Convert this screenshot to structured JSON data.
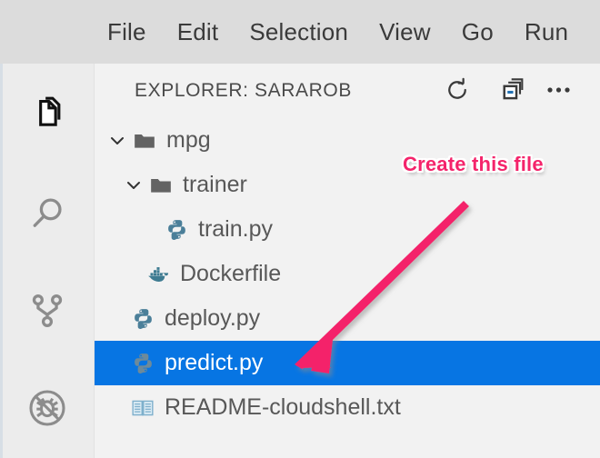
{
  "menubar": {
    "items": [
      {
        "label": "File"
      },
      {
        "label": "Edit"
      },
      {
        "label": "Selection"
      },
      {
        "label": "View"
      },
      {
        "label": "Go"
      },
      {
        "label": "Run"
      }
    ]
  },
  "activitybar": {
    "items": [
      {
        "icon": "files-icon",
        "name": "explorer",
        "active": true
      },
      {
        "icon": "search-icon",
        "name": "search",
        "active": false
      },
      {
        "icon": "source-control-icon",
        "name": "source-control",
        "active": false
      },
      {
        "icon": "run-and-debug-icon",
        "name": "run-and-debug",
        "active": false
      }
    ]
  },
  "explorer": {
    "title": "EXPLORER: SARAROB",
    "actions": [
      {
        "icon": "refresh-icon",
        "name": "refresh"
      },
      {
        "icon": "collapse-all-icon",
        "name": "collapse-all"
      },
      {
        "icon": "more-actions-icon",
        "name": "more-actions"
      }
    ],
    "tree": [
      {
        "label": "mpg",
        "type": "folder",
        "icon": "folder-icon",
        "expanded": true,
        "indent": 0,
        "selected": false
      },
      {
        "label": "trainer",
        "type": "folder",
        "icon": "folder-icon",
        "expanded": true,
        "indent": 1,
        "selected": false
      },
      {
        "label": "train.py",
        "type": "file",
        "icon": "python-icon",
        "indent": 3,
        "selected": false
      },
      {
        "label": "Dockerfile",
        "type": "file",
        "icon": "docker-icon",
        "indent": 2,
        "selected": false
      },
      {
        "label": "deploy.py",
        "type": "file",
        "icon": "python-icon",
        "indent": 1,
        "selected": false
      },
      {
        "label": "predict.py",
        "type": "file",
        "icon": "python-icon",
        "indent": 1,
        "selected": true
      },
      {
        "label": "README-cloudshell.txt",
        "type": "file",
        "icon": "book-icon",
        "indent": 1,
        "selected": false
      }
    ]
  },
  "annotation": {
    "text": "Create this file",
    "arrow_color": "#f4246b",
    "text_color": "#f4246b",
    "points_to": "predict.py"
  },
  "colors": {
    "menubar_background": "#dcdcdc",
    "activitybar_background": "#ececec",
    "panel_background": "#f2f2f2",
    "selection_blue": "#0775e3",
    "python_icon": "#4b7f99",
    "docker_icon": "#3e7b91",
    "book_icon": "#7fb0cc",
    "folder_icon": "#636363",
    "text": "#585858",
    "annotation_pink": "#f4246b"
  }
}
